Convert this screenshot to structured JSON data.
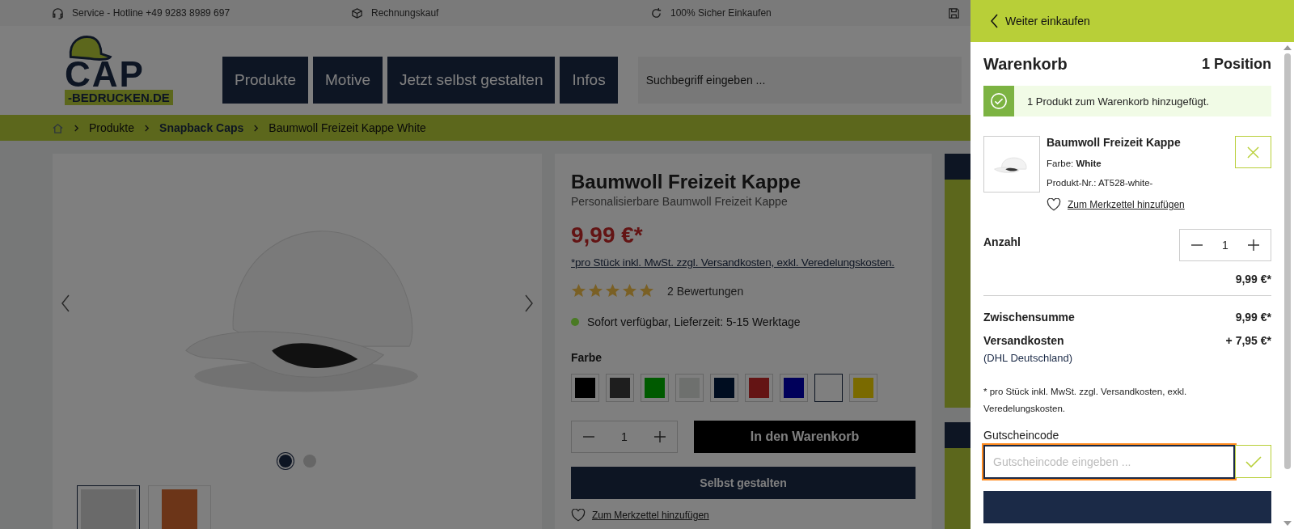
{
  "top_bar": [
    {
      "text": "Service - Hotline +49 9283 8989 697"
    },
    {
      "text": "Rechnungskauf"
    },
    {
      "text": "100% Sicher Einkaufen"
    }
  ],
  "logo": {
    "main": "CAP",
    "sub": "-BEDRUCKEN.DE"
  },
  "nav": [
    "Produkte",
    "Motive",
    "Jetzt selbst gestalten",
    "Infos"
  ],
  "search": {
    "placeholder": "Suchbegriff eingeben ..."
  },
  "breadcrumb": [
    {
      "label": "Produkte",
      "bold": false
    },
    {
      "label": "Snapback Caps",
      "bold": true
    },
    {
      "label": "Baumwoll Freizeit Kappe White",
      "bold": false
    }
  ],
  "gallery": {
    "dots": [
      {
        "selected": true
      },
      {
        "selected": false
      }
    ],
    "thumbnails": [
      {
        "selected": true
      },
      {
        "selected": false
      }
    ]
  },
  "product": {
    "title": "Baumwoll Freizeit Kappe",
    "subtitle": "Personalisierbare Baumwoll Freizeit Kappe",
    "price": "9,99 €*",
    "price_note": "*pro Stück inkl. MwSt. zzgl. Versandkosten, exkl. Veredelungskosten.",
    "stars": 5,
    "reviews": "2 Bewertungen",
    "availability": {
      "text": "Sofort verfügbar, Lieferzeit: 5-15 Werktage",
      "color": "#4a7a24"
    },
    "color_label": "Farbe",
    "swatches": [
      {
        "color": "#000000",
        "selected": false
      },
      {
        "color": "#1e1e1e",
        "selected": false
      },
      {
        "color": "#005a00",
        "selected": false
      },
      {
        "color": "#6e706e",
        "selected": false
      },
      {
        "color": "#000d20",
        "selected": false
      },
      {
        "color": "#641414",
        "selected": false
      },
      {
        "color": "#00005a",
        "selected": false
      },
      {
        "color": "#7f7f7f",
        "selected": true
      },
      {
        "color": "#7a6a00",
        "selected": false
      }
    ],
    "quantity": "1",
    "add_to_cart": "In den Warenkorb",
    "customize": "Selbst gestalten",
    "wishlist": "Zum Merkzettel hinzufügen"
  },
  "cart": {
    "back": "Weiter einkaufen",
    "title": "Warenkorb",
    "count": "1 Position",
    "alert": "1 Produkt zum Warenkorb hinzugefügt.",
    "item": {
      "name": "Baumwoll Freizeit Kappe",
      "color_label": "Farbe:",
      "color_value": "White",
      "sku": "Produkt-Nr.: AT528-white-",
      "wishlist": "Zum Merkzettel hinzufügen"
    },
    "quantity_label": "Anzahl",
    "quantity": "1",
    "line_total": "9,99 €*",
    "subtotal_label": "Zwischensumme",
    "subtotal": "9,99 €*",
    "shipping_label": "Versandkosten",
    "shipping": "+ 7,95 €*",
    "shipping_method": "(DHL Deutschland)",
    "note": "* pro Stück inkl. MwSt. zzgl. Versandkosten, exkl. Veredelungskosten.",
    "voucher_label": "Gutscheincode",
    "voucher": {
      "placeholder": "Gutscheincode eingeben ..."
    }
  }
}
